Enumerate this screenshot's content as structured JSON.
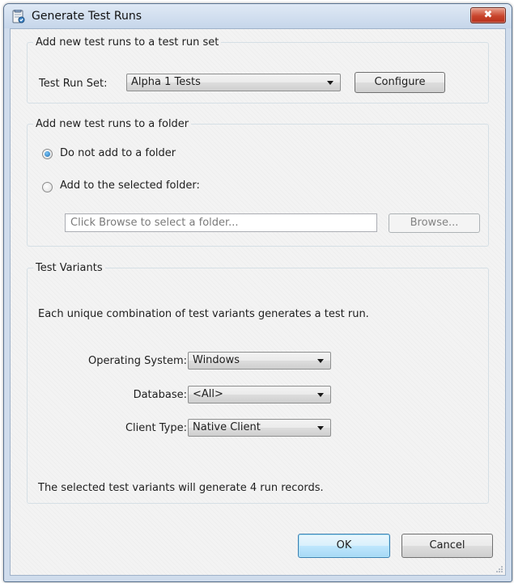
{
  "window": {
    "title": "Generate Test Runs",
    "close_glyph": "✖"
  },
  "test_run_set_group": {
    "legend": "Add new test runs to a test run set",
    "label": "Test Run Set:",
    "selected": "Alpha 1 Tests",
    "configure_label": "Configure"
  },
  "folder_group": {
    "legend": "Add new test runs to a folder",
    "option_no_folder": "Do not add to a folder",
    "option_selected_folder": "Add to the selected folder:",
    "selected_option": "no_folder",
    "folder_placeholder": "Click Browse to select a folder...",
    "browse_label": "Browse..."
  },
  "variants_group": {
    "legend": "Test Variants",
    "description": "Each unique combination of test variants generates a test run.",
    "os_label": "Operating System:",
    "os_value": "Windows",
    "database_label": "Database:",
    "database_value": "<All>",
    "client_label": "Client Type:",
    "client_value": "Native Client",
    "summary": "The selected test variants will generate 4 run records."
  },
  "footer": {
    "ok_label": "OK",
    "cancel_label": "Cancel"
  },
  "colors": {
    "accent": "#3c7fb1",
    "close_button": "#c8442c",
    "frame": "#cfdcec"
  }
}
